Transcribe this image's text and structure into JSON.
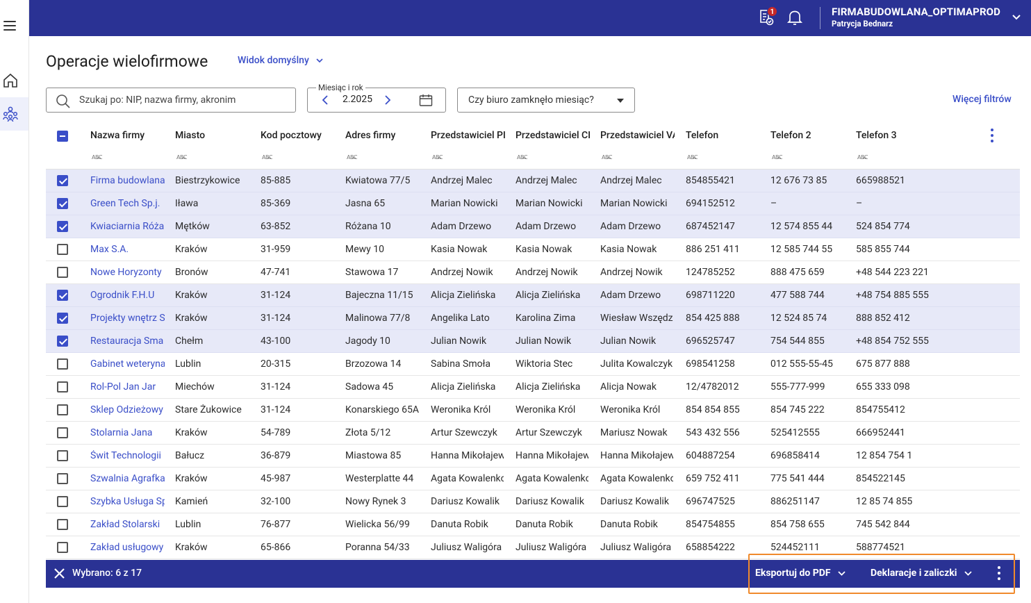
{
  "topbar": {
    "notification_count": "1",
    "company": "FIRMABUDOWLANA_OPTIMAPROD",
    "user": "Patrycja Bednarz"
  },
  "header": {
    "title": "Operacje wielofirmowe",
    "view": "Widok domyślny"
  },
  "filters": {
    "search_placeholder": "Szukaj po: NIP, nazwa firmy, akronim",
    "month_label": "Miesiąc i rok",
    "month_value": "2.2025",
    "closed_select": "Czy biuro zamknęło miesiąc?",
    "more_filters": "Więcej filtrów"
  },
  "table": {
    "columns": [
      "Nazwa firmy",
      "Miasto",
      "Kod pocztowy",
      "Adres firmy",
      "Przedstawiciel PI",
      "Przedstawiciel CI",
      "Przedstawiciel VA",
      "Telefon",
      "Telefon 2",
      "Telefon 3"
    ],
    "filter_glyph": "ABC",
    "rows": [
      {
        "selected": true,
        "cells": [
          "Firma budowlana",
          "Biestrzykowice",
          "85-885",
          "Kwiatowa 77/5",
          "Andrzej Malec",
          "Andrzej Malec",
          "Andrzej Malec",
          "854855421",
          "12 676 73 85",
          "665988521"
        ]
      },
      {
        "selected": true,
        "cells": [
          "Green Tech Sp.j.",
          "Iława",
          "85-369",
          "Jasna 65",
          "Marian Nowicki",
          "Marian Nowicki",
          "Marian Nowicki",
          "694152512",
          "–",
          "–"
        ]
      },
      {
        "selected": true,
        "cells": [
          "Kwiaciarnia Róża",
          "Mętków",
          "63-852",
          "Różana 10",
          "Adam Drzewo",
          "Adam Drzewo",
          "Adam Drzewo",
          "687452147",
          "12 574 855 44",
          "524 854 774"
        ]
      },
      {
        "selected": false,
        "cells": [
          "Max S.A.",
          "Kraków",
          "31-959",
          "Mewy 10",
          "Kasia Nowak",
          "Kasia Nowak",
          "Kasia Nowak",
          "886 251 411",
          "12 585 744 55",
          "585 855 744"
        ]
      },
      {
        "selected": false,
        "cells": [
          "Nowe Horyzonty",
          "Bronów",
          "47-741",
          "Stawowa 17",
          "Andrzej Nowik",
          "Andrzej Nowik",
          "Andrzej Nowik",
          "124785252",
          "888 475 659",
          "+48 544 223 221"
        ]
      },
      {
        "selected": true,
        "cells": [
          "Ogrodnik F.H.U",
          "Kraków",
          "31-124",
          "Bajeczna 11/15",
          "Alicja Zielińska",
          "Alicja Zielińska",
          "Adam Drzewo",
          "698711220",
          "477 588 744",
          "+48 754 885 555"
        ]
      },
      {
        "selected": true,
        "cells": [
          "Projekty wnętrz S",
          "Kraków",
          "31-124",
          "Malinowa 77/8",
          "Angelika Lato",
          "Karolina Zima",
          "Wiesław Wszędzi",
          "854 425 888",
          "12 524 85 74",
          "888 852 412"
        ]
      },
      {
        "selected": true,
        "cells": [
          "Restauracja Sma",
          "Chełm",
          "43-100",
          "Jagody 10",
          "Julian Nowik",
          "Julian Nowik",
          "Julian Nowik",
          "696525747",
          "754 544 855",
          "+48 854 752 555"
        ]
      },
      {
        "selected": false,
        "cells": [
          "Gabinet weteryna",
          "Lublin",
          "20-315",
          "Brzozowa 14",
          "Sabina Smoła",
          "Wiktoria Stec",
          "Julita Kowalczyk",
          "698541258",
          "012 555-55-45",
          "675 877 888"
        ]
      },
      {
        "selected": false,
        "cells": [
          "Rol-Pol Jan Jar",
          "Miechów",
          "31-124",
          "Sadowa 45",
          "Alicja Zielińska",
          "Alicja Zielińska",
          "Alicja Nowak",
          "12/4782012",
          "555-777-999",
          "655 333 098"
        ]
      },
      {
        "selected": false,
        "cells": [
          "Sklep Odzieżowy",
          "Stare Żukowice",
          "31-124",
          "Konarskiego 65A",
          "Weronika Król",
          "Weronika Król",
          "Weronika Król",
          "854 854 855",
          "854 745 222",
          "854755412"
        ]
      },
      {
        "selected": false,
        "cells": [
          "Stolarnia Jana",
          "Kraków",
          "54-789",
          "Złota 5/12",
          "Artur Szewczyk",
          "Artur Szewczyk",
          "Mariusz Nowak",
          "543 432 556",
          "525412555",
          "666952441"
        ]
      },
      {
        "selected": false,
        "cells": [
          "Świt Technologii",
          "Bałucz",
          "36-879",
          "Miastowa 85",
          "Hanna Mikołajew",
          "Hanna Mikołajew",
          "Hanna Mikołajew",
          "604887254",
          "696858414",
          "12 854 754 1"
        ]
      },
      {
        "selected": false,
        "cells": [
          "Szwalnia Agrafka",
          "Kraków",
          "45-987",
          "Westerplatte 44",
          "Agata Kowalenko",
          "Agata Kowalenko",
          "Agata Kowalenko",
          "659 752 411",
          "775 541 444",
          "854522145"
        ]
      },
      {
        "selected": false,
        "cells": [
          "Szybka Usługa Sp",
          "Kamień",
          "32-100",
          "Nowy Rynek 3",
          "Dariusz Kowalik",
          "Dariusz Kowalik",
          "Dariusz Kowalik",
          "696747525",
          "886251147",
          "12 85 74 855"
        ]
      },
      {
        "selected": false,
        "cells": [
          "Zakład Stolarski",
          "Lublin",
          "76-877",
          "Wielicka 56/99",
          "Danuta Robik",
          "Danuta Robik",
          "Danuta Robik",
          "854754855",
          "854 758 655",
          "745 542 844"
        ]
      },
      {
        "selected": false,
        "cells": [
          "Zakład usługowy",
          "Kraków",
          "65-866",
          "Poranna 54/33",
          "Juliusz Waligóra",
          "Juliusz Waligóra",
          "Juliusz Waligóra",
          "658854222",
          "524452111",
          "588774521"
        ]
      }
    ]
  },
  "bottombar": {
    "selection": "Wybrano: 6 z 17",
    "export": "Eksportuj do PDF",
    "declarations": "Deklaracje i zaliczki"
  },
  "colors": {
    "primary": "#2a3294",
    "accent": "#3a4ec8",
    "selected_row": "#e7e9f8",
    "highlight": "#f08a2c",
    "badge": "#c62828"
  }
}
